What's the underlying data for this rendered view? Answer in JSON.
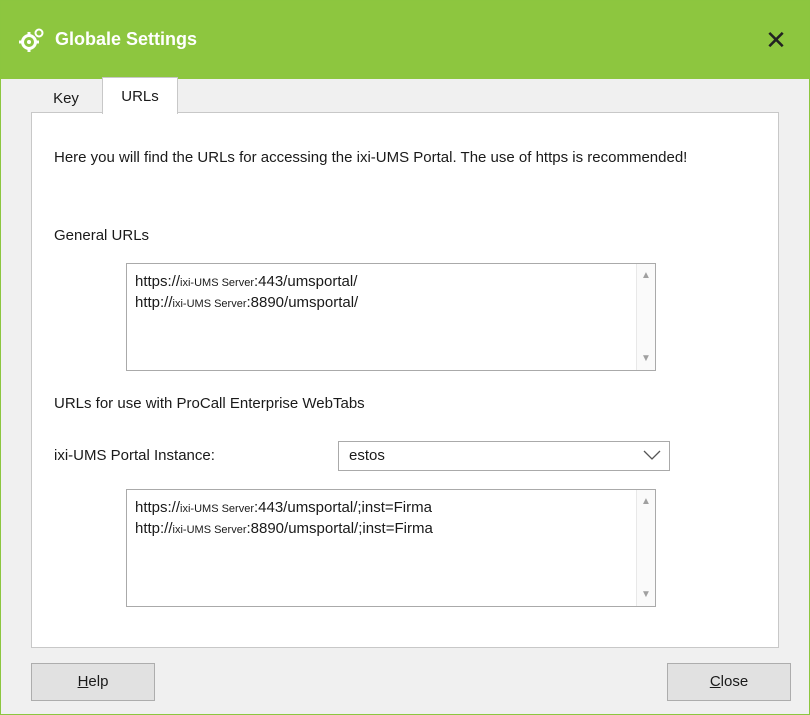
{
  "window": {
    "title": "Globale Settings"
  },
  "tabs": [
    {
      "label": "Key"
    },
    {
      "label": "URLs"
    }
  ],
  "intro": "Here you will find the URLs for accessing the ixi-UMS Portal. The use of https is recommended!",
  "general": {
    "label": "General URLs",
    "lines": [
      {
        "prefix": "https://",
        "host": "ixi-UMS Server",
        "suffix": ":443/umsportal/"
      },
      {
        "prefix": "http://",
        "host": "ixi-UMS Server",
        "suffix": ":8890/umsportal/"
      }
    ]
  },
  "procall": {
    "label": "URLs for use with ProCall Enterprise WebTabs",
    "instance_label": "ixi-UMS Portal Instance:",
    "instance_value": "estos",
    "lines": [
      {
        "prefix": "https://",
        "host": "ixi-UMS Server",
        "suffix": ":443/umsportal/;inst=Firma"
      },
      {
        "prefix": "http://",
        "host": "ixi-UMS Server",
        "suffix": ":8890/umsportal/;inst=Firma"
      }
    ]
  },
  "buttons": {
    "help_first": "H",
    "help_rest": "elp",
    "close_first": "C",
    "close_rest": "lose"
  },
  "colors": {
    "titlebar": "#8dc63f",
    "title_text": "#ffffff"
  },
  "icons": {
    "title": "gears-icon",
    "close": "close-icon",
    "dropdown": "chevron-down-icon"
  }
}
